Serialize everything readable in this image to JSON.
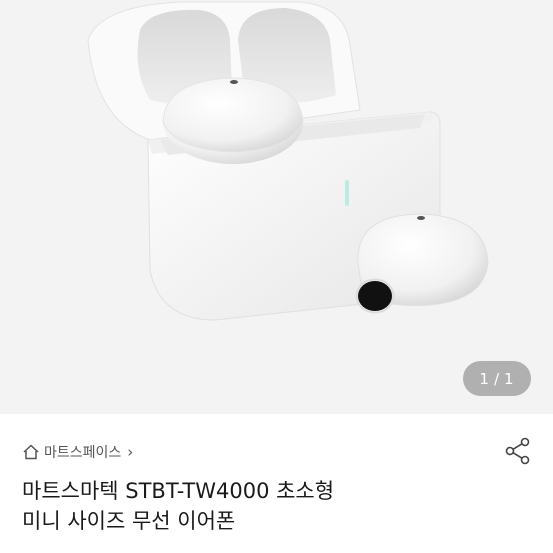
{
  "gallery": {
    "image_alt": "white wireless earbuds with charging case",
    "counter": {
      "current": "1",
      "separator": "/",
      "total": "1"
    }
  },
  "breadcrumb": {
    "home_icon": "home-icon",
    "store": "마트스페이스",
    "chevron_icon": "chevron-right-icon"
  },
  "share": {
    "icon": "share-icon"
  },
  "product": {
    "title_line1": "마트스마텍 STBT-TW4000 초소형",
    "title_line2": "미니 사이즈 무선 이어폰"
  },
  "colors": {
    "gallery_bg": "#f3f3f3",
    "counter_bg": "#8a8a8a",
    "text": "#1a1a1a"
  }
}
